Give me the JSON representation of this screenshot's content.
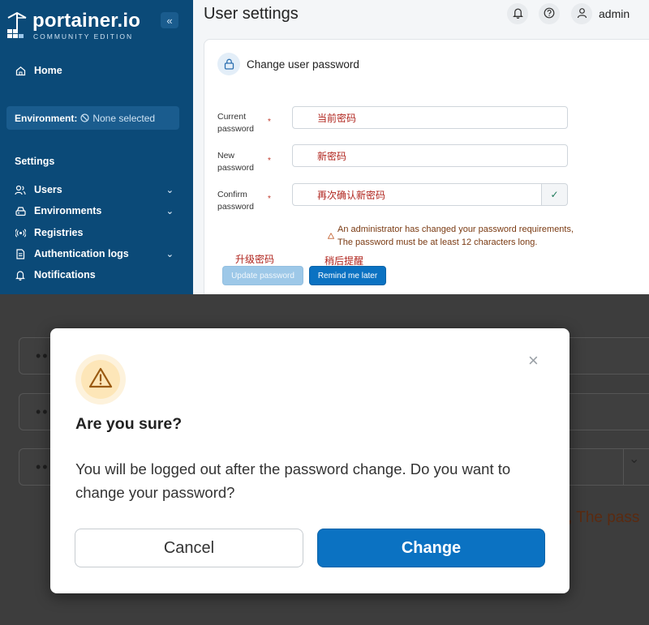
{
  "top_screenshot": {
    "sidebar": {
      "logo_name": "portainer.io",
      "logo_sub": "COMMUNITY EDITION",
      "collapse_icon": "«",
      "home": "Home",
      "environment_label": "Environment:",
      "environment_value": "None selected",
      "settings_heading": "Settings",
      "items": [
        {
          "label": "Users",
          "icon": "users-icon",
          "has_chevron": true
        },
        {
          "label": "Environments",
          "icon": "environments-icon",
          "has_chevron": true
        },
        {
          "label": "Registries",
          "icon": "registries-icon",
          "has_chevron": false
        },
        {
          "label": "Authentication logs",
          "icon": "auth-logs-icon",
          "has_chevron": true
        },
        {
          "label": "Notifications",
          "icon": "bell-icon",
          "has_chevron": false
        }
      ],
      "chevron": "⌄"
    },
    "header": {
      "title": "User settings",
      "user": "admin"
    },
    "card": {
      "title": "Change user password",
      "fields": {
        "current_label": "Current password",
        "current_value": "当前密码",
        "new_label": "New password",
        "new_value": "新密码",
        "confirm_label": "Confirm password",
        "confirm_value": "再次确认新密码",
        "required_mark": "*",
        "check_icon": "✓"
      },
      "warning_line1": "An administrator has changed your password requirements,",
      "warning_line2": "The password must be at least 12 characters long.",
      "annotation_update": "升级密码",
      "annotation_remind": "稍后提醒",
      "update_button": "Update password",
      "remind_button": "Remind me later"
    }
  },
  "bottom_screenshot": {
    "background_dots": "••",
    "background_text": ", The pass",
    "background_chevron": "⌄",
    "modal": {
      "close_icon": "×",
      "title": "Are you sure?",
      "body": "You will be logged out after the password change. Do you want to change your password?",
      "cancel_button": "Cancel",
      "confirm_button": "Change"
    }
  },
  "colors": {
    "sidebar_bg": "#0b4a78",
    "primary_button": "#0b72c2",
    "annotation_red": "#b0251e",
    "warning_brown": "#7a3a12"
  }
}
